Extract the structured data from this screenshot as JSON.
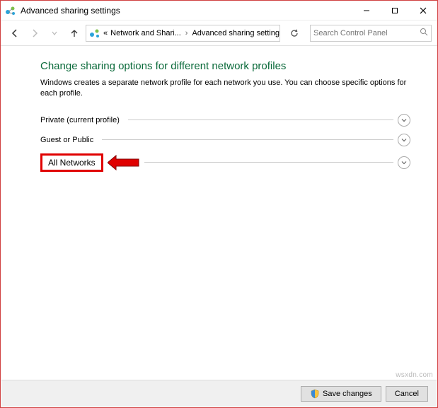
{
  "window": {
    "title": "Advanced sharing settings"
  },
  "nav": {
    "breadcrumb_prefix": "«",
    "crumb1": "Network and Shari...",
    "crumb2": "Advanced sharing settings"
  },
  "search": {
    "placeholder": "Search Control Panel"
  },
  "page": {
    "heading": "Change sharing options for different network profiles",
    "description": "Windows creates a separate network profile for each network you use. You can choose specific options for each profile."
  },
  "sections": {
    "private": "Private (current profile)",
    "guest": "Guest or Public",
    "all": "All Networks"
  },
  "footer": {
    "save": "Save changes",
    "cancel": "Cancel"
  },
  "watermark": "wsxdn.com"
}
